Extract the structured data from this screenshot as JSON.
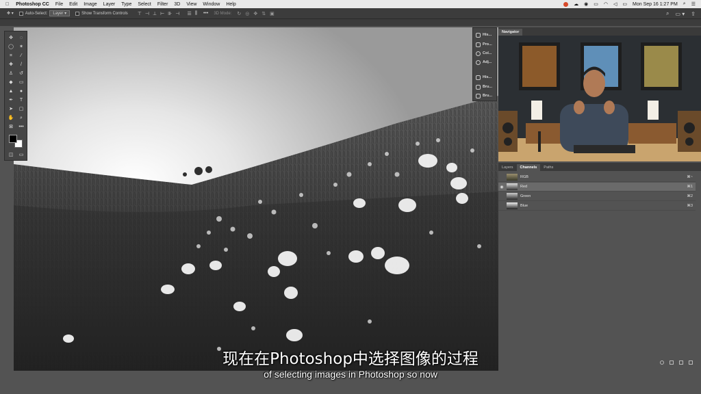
{
  "menubar": {
    "app_name": "Photoshop CC",
    "items": [
      "File",
      "Edit",
      "Image",
      "Layer",
      "Type",
      "Select",
      "Filter",
      "3D",
      "View",
      "Window",
      "Help"
    ],
    "clock": "Mon Sep 16  1:27 PM"
  },
  "options": {
    "auto_select_label": "Auto-Select:",
    "auto_select_value": "Layer",
    "show_transform_label": "Show Transform Controls",
    "mode_3d_label": "3D Mode:"
  },
  "collapsed_panels": [
    "His...",
    "Pro...",
    "Col...",
    "Adj...",
    "His...",
    "Bru...",
    "Bru..."
  ],
  "navigator": {
    "tab": "Navigator"
  },
  "channels": {
    "tabs": [
      "Layers",
      "Channels",
      "Paths"
    ],
    "active_tab": "Channels",
    "rows": [
      {
        "name": "RGB",
        "shortcut": "⌘~"
      },
      {
        "name": "Red",
        "shortcut": "⌘1"
      },
      {
        "name": "Green",
        "shortcut": "⌘2"
      },
      {
        "name": "Blue",
        "shortcut": "⌘3"
      }
    ]
  },
  "subtitles": {
    "chinese": "现在在Photoshop中选择图像的过程",
    "english": "of selecting images in Photoshop so now"
  },
  "colors": {
    "ui_dark": "#3c3c3c",
    "ui_panel": "#535353",
    "accent_video_wall": "#2b2f33"
  }
}
